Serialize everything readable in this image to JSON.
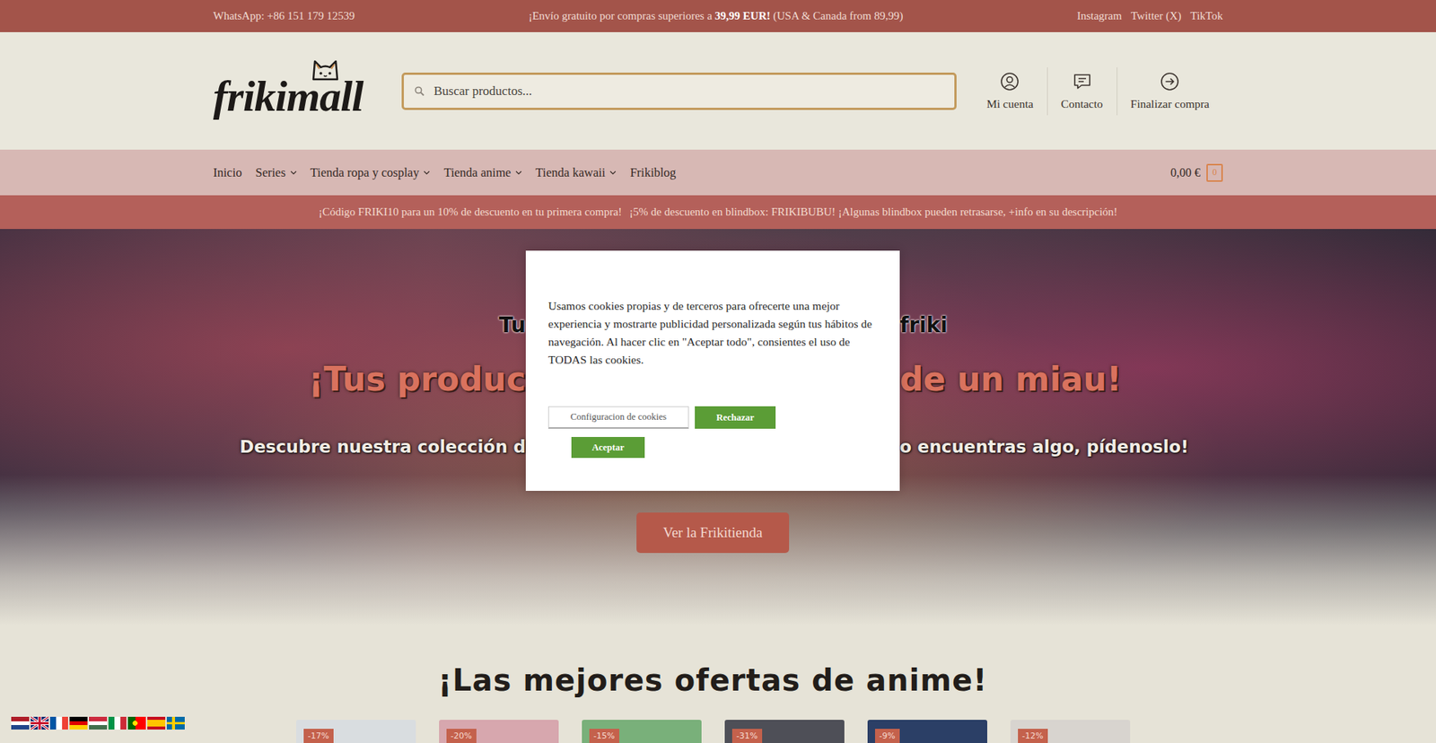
{
  "topbar": {
    "whatsapp": "WhatsApp: +86 151 179 12539",
    "shipping": {
      "before": "¡Envío gratuito por compras superiores a ",
      "amount": "39,99 EUR!",
      "after": " (USA & Canada from 89,99)"
    },
    "social": [
      "Instagram",
      "Twitter (X)",
      "TikTok"
    ]
  },
  "header": {
    "logo": "frikimall",
    "search": {
      "placeholder": "Buscar productos..."
    },
    "actions": [
      "Mi cuenta",
      "Contacto",
      "Finalizar compra"
    ]
  },
  "nav": {
    "items": [
      {
        "label": "Inicio",
        "dropdown": false
      },
      {
        "label": "Series",
        "dropdown": true
      },
      {
        "label": "Tienda ropa y cosplay",
        "dropdown": true
      },
      {
        "label": "Tienda anime",
        "dropdown": true
      },
      {
        "label": "Tienda kawaii",
        "dropdown": true
      },
      {
        "label": "Frikiblog",
        "dropdown": false
      }
    ],
    "cart": {
      "total": "0,00 €",
      "count": "0"
    }
  },
  "promo": [
    "¡Código FRIKI10 para un 10% de descuento en tu primera compra!",
    "¡5% de descuento en blindbox: FRIKIBUBU! ¡Algunas blindbox pueden retrasarse, +info en su descripción!"
  ],
  "hero": {
    "title": [
      "Tu",
      "friki"
    ],
    "subtitle": [
      "¡Tus produc",
      "de un miau!"
    ],
    "description": [
      "Descubre nuestra colección d",
      "o encuentras algo, pídenoslo!"
    ],
    "button": "Ver la Frikitienda"
  },
  "deals": {
    "title": "¡Las mejores ofertas de anime!",
    "products": [
      {
        "badge": "-17%"
      },
      {
        "badge": "-20%"
      },
      {
        "badge": "-15%"
      },
      {
        "badge": "-31%"
      },
      {
        "badge": "-9%"
      },
      {
        "badge": "-12%"
      }
    ]
  },
  "languages": [
    {
      "kind": "nl"
    },
    {
      "kind": "en"
    },
    {
      "kind": "fr"
    },
    {
      "kind": "de"
    },
    {
      "kind": "hu"
    },
    {
      "kind": "it"
    },
    {
      "kind": "pt"
    },
    {
      "kind": "es"
    },
    {
      "kind": "sv"
    }
  ],
  "cookie_modal": {
    "text": "Usamos cookies propias y de terceros para ofrecerte una mejor experiencia y mostrarte publicidad personalizada según tus hábitos de navegación. Al hacer clic en \"Aceptar todo\", consientes el uso de TODAS las cookies.",
    "buttons": [
      {
        "label": "Configuracion de cookies",
        "kind": "outline"
      },
      {
        "label": "Rechazar",
        "kind": "solid"
      },
      {
        "label": "Aceptar",
        "kind": "solid"
      }
    ]
  }
}
